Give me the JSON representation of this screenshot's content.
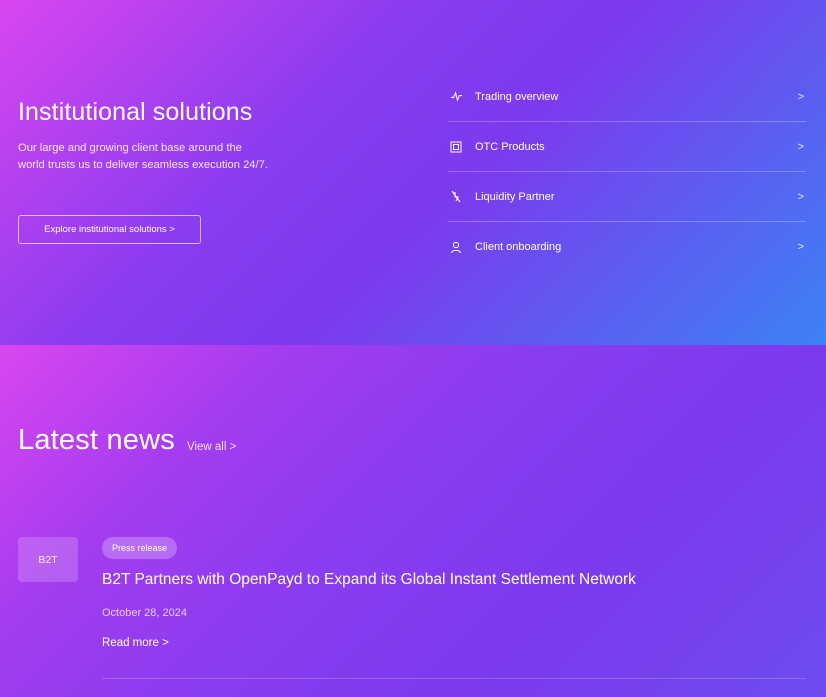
{
  "institutional": {
    "title": "Institutional solutions",
    "description": "Our large and growing client base around the world trusts us to deliver seamless execution 24/7.",
    "cta_label": "Explore institutional solutions >",
    "items": [
      {
        "label": "Trading overview",
        "icon": "activity-icon",
        "chevron": ">"
      },
      {
        "label": "OTC Products",
        "icon": "square-icon",
        "chevron": ">"
      },
      {
        "label": "Liquidity Partner",
        "icon": "liquidity-icon",
        "chevron": ">"
      },
      {
        "label": "Client onboarding",
        "icon": "user-icon",
        "chevron": ">"
      }
    ]
  },
  "news": {
    "title": "Latest news",
    "view_all": "View all >",
    "articles": [
      {
        "thumb_text": "B2T",
        "badge": "Press release",
        "headline": "B2T Partners with OpenPayd to Expand its Global Instant Settlement Network",
        "date": "October 28, 2024",
        "read_more": "Read more >"
      }
    ]
  },
  "colors": {
    "gradient_start": "#d946ef",
    "gradient_mid": "#7c3aed",
    "gradient_end": "#3b82f6"
  }
}
